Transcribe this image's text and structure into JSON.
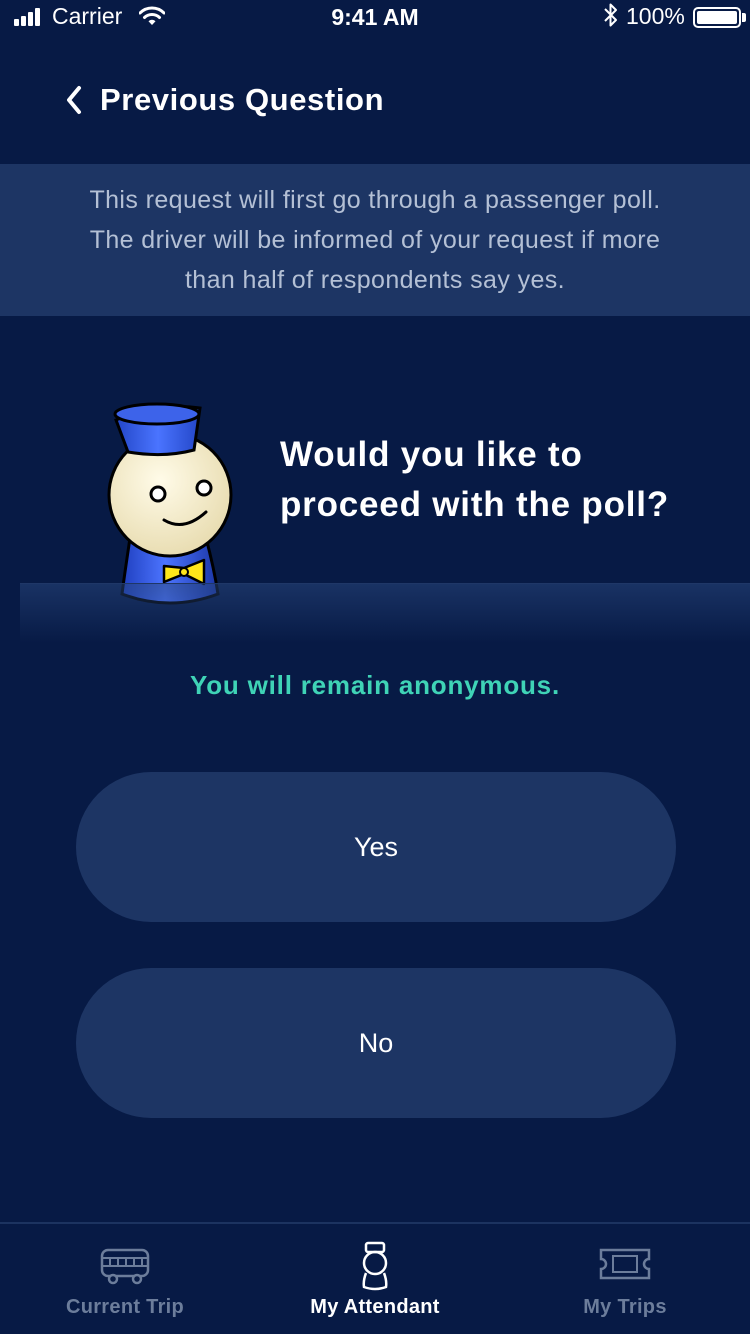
{
  "status_bar": {
    "carrier": "Carrier",
    "time": "9:41 AM",
    "battery": "100%"
  },
  "nav": {
    "back_label": "Previous Question"
  },
  "banner": {
    "lines": [
      "This request will first go through a passenger poll.",
      "The driver will be informed of your request if more",
      "than half of respondents say yes."
    ]
  },
  "question": {
    "lines": [
      "Would you like to",
      "proceed with the poll?"
    ]
  },
  "anonymous_note": "You will remain anonymous.",
  "buttons": {
    "yes": "Yes",
    "no": "No"
  },
  "tabs": [
    {
      "label": "Current Trip",
      "icon": "bus-icon",
      "active": false
    },
    {
      "label": "My Attendant",
      "icon": "attendant-icon",
      "active": true
    },
    {
      "label": "My Trips",
      "icon": "ticket-icon",
      "active": false
    }
  ],
  "colors": {
    "background": "#071a45",
    "panel": "#1d3564",
    "accent": "#3fd3b6",
    "inactive_tab": "#6c7d9b"
  }
}
